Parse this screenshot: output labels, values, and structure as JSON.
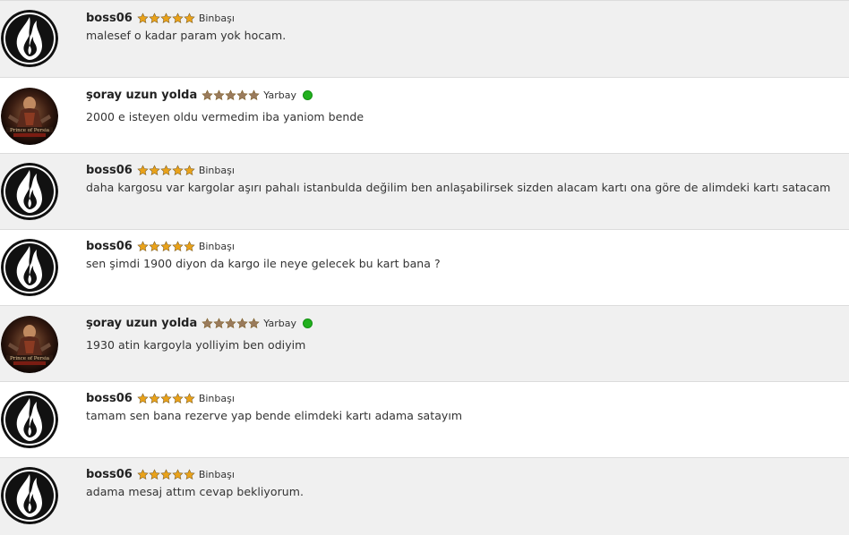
{
  "posts": [
    {
      "username": "boss06",
      "rank": "Binbaşı",
      "avatar": "fire-avatar",
      "stars": 5,
      "online": false,
      "message": "malesef o kadar param yok hocam."
    },
    {
      "username": "şoray uzun yolda",
      "rank": "Yarbay",
      "avatar": "prince-of-persia-avatar",
      "stars": 5,
      "online": true,
      "message": "2000 e isteyen oldu vermedim iba yaniom bende"
    },
    {
      "username": "boss06",
      "rank": "Binbaşı",
      "avatar": "fire-avatar",
      "stars": 5,
      "online": false,
      "message": "daha kargosu var kargolar aşırı pahalı istanbulda değilim ben anlaşabilirsek sizden alacam kartı ona göre de alimdeki kartı satacam"
    },
    {
      "username": "boss06",
      "rank": "Binbaşı",
      "avatar": "fire-avatar",
      "stars": 5,
      "online": false,
      "message": "sen şimdi 1900 diyon da kargo ile neye gelecek bu kart bana ?"
    },
    {
      "username": "şoray uzun yolda",
      "rank": "Yarbay",
      "avatar": "prince-of-persia-avatar",
      "stars": 5,
      "online": true,
      "message": "1930 atin kargoyla yolliyim ben odiyim"
    },
    {
      "username": "boss06",
      "rank": "Binbaşı",
      "avatar": "fire-avatar",
      "stars": 5,
      "online": false,
      "message": "tamam sen bana rezerve yap bende elimdeki kartı adama satayım"
    },
    {
      "username": "boss06",
      "rank": "Binbaşı",
      "avatar": "fire-avatar",
      "stars": 5,
      "online": false,
      "message": "adama mesaj attım cevap bekliyorum."
    }
  ],
  "colors": {
    "gold_star": "#e9a21a",
    "bronze_star": "#9a7b5c",
    "online": "#22b01e",
    "row_gray": "#f0f0f0",
    "row_white": "#ffffff"
  },
  "icons": {
    "fire_avatar": "fire-avatar-icon",
    "prince_avatar": "prince-of-persia-avatar-icon",
    "star": "star-icon",
    "online": "online-status-icon"
  }
}
